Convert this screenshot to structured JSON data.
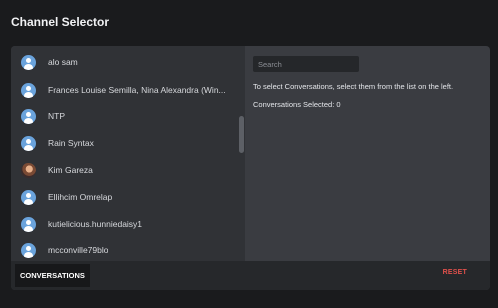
{
  "app": {
    "title": "Channel Selector"
  },
  "channels": [
    {
      "label": "alo sam",
      "avatar": "default-user-icon"
    },
    {
      "label": "Frances Louise Semilla, Nina Alexandra (Win...",
      "avatar": "default-user-icon"
    },
    {
      "label": "NTP",
      "avatar": "default-user-icon"
    },
    {
      "label": "Rain Syntax",
      "avatar": "default-user-icon"
    },
    {
      "label": "Kim Gareza",
      "avatar": "user-photo"
    },
    {
      "label": "Ellihcim Omrelap",
      "avatar": "default-user-icon"
    },
    {
      "label": "kutielicious.hunniedaisy1",
      "avatar": "default-user-icon"
    },
    {
      "label": "mcconville79blo",
      "avatar": "default-user-icon"
    }
  ],
  "search": {
    "placeholder": "Search",
    "value": ""
  },
  "instructions": "To select Conversations, select them from the list on the left.",
  "selected_count_text": "Conversations Selected: 0",
  "footer": {
    "conversations_tab": "CONVERSATIONS",
    "reset_label": "RESET"
  },
  "colors": {
    "accent_avatar": "#6aa3dc",
    "reset": "#e0504b",
    "panel": "#3a3c41",
    "list": "#303236"
  }
}
